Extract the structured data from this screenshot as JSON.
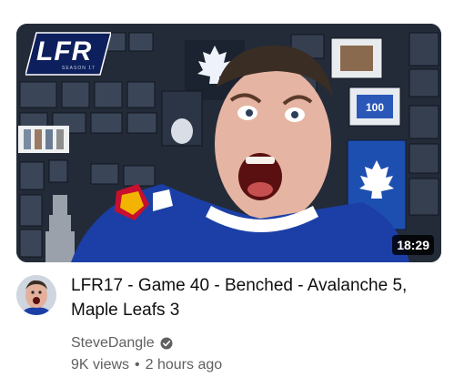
{
  "video": {
    "title": "LFR17 - Game 40 - Benched - Avalanche 5, Maple Leafs 3",
    "duration": "18:29",
    "thumbnail_logo": "LFR",
    "thumbnail_logo_sub": "SEASON 17"
  },
  "channel": {
    "name": "SteveDangle",
    "verified_icon": "verified-check-icon"
  },
  "stats": {
    "views": "9K views",
    "separator": "•",
    "age": "2 hours ago"
  },
  "colors": {
    "jersey_blue": "#1b3fa6",
    "logo_badge": "#0d1f5c",
    "meta_text": "#606060",
    "title_text": "#0f0f0f"
  }
}
